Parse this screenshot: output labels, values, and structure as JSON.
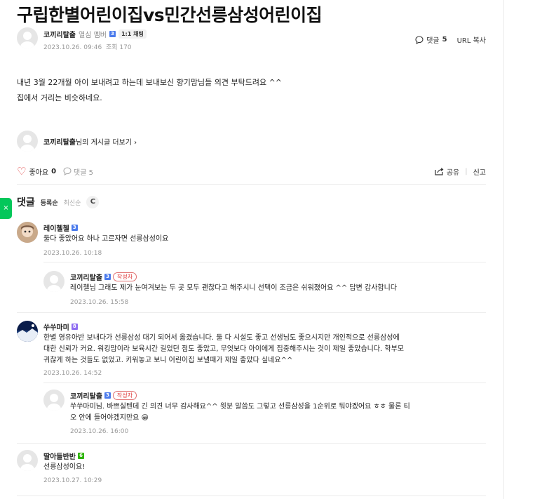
{
  "post": {
    "title": "구립한별어린이집vs민간선릉삼성어린이집",
    "author": "코끼리탈출",
    "grade": "열심 멤버",
    "grade_badge": "3",
    "chat_label": "1:1 채팅",
    "date": "2023.10.26. 09:46",
    "views": "조회 170",
    "comment_label": "댓글",
    "comment_count": "5",
    "url_copy": "URL 복사",
    "body_line1": "내년 3월 22개월 아이 보내려고 하는데 보내보신 향기맘님들 의견 부탁드려요 ^^",
    "body_line2": "집에서 거리는 비슷하네요.",
    "more_author": "코끼리탈출",
    "more_suffix": "님의 게시글 더보기 ›"
  },
  "reactions": {
    "like_label": "좋아요",
    "like_count": "0",
    "comment_label": "댓글 5",
    "share_label": "공유",
    "report_label": "신고"
  },
  "comments_section": {
    "heading": "댓글",
    "sort_registered": "등록순",
    "sort_latest": "최신순",
    "refresh_icon": "C"
  },
  "comments": [
    {
      "name": "레이첼첼",
      "badge": "3",
      "text": "둘다 좋았어요 하나 고르자면 선릉삼성이요",
      "date": "2023.10.26. 10:18"
    },
    {
      "name": "코끼리탈출",
      "badge": "3",
      "tag": "작성자",
      "text": "레이첼님 그래도 제가 눈여겨보는 두 곳 모두 괜찮다고 해주시니 선택이 조금은 쉬워졌어요 ^^ 답변 감사합니다",
      "date": "2023.10.26. 15:58"
    },
    {
      "name": "쑤쑤마미",
      "badge": "8",
      "text_l1": "한별 영유아반 보내다가 선릉삼성 대기 되어서 옮겼습니다. 둘 다 시설도 좋고 선생님도 좋으시지만 개인적으로 선릉삼성에",
      "text_l2": "대한 신뢰가 커요. 워킹맘이라 보육시간 길었던 점도 좋았고, 무엇보다 아이에게 집중해주시는 것이 제일 좋았습니다. 학부모",
      "text_l3": "귀찮게 하는 것들도 없었고. 키워놓고 보니 어린이집 보낼때가 제일 좋았다 싶네요^^",
      "date": "2023.10.26. 14:52"
    },
    {
      "name": "코끼리탈출",
      "badge": "3",
      "tag": "작성자",
      "text_l1": "쑤쑤마미님. 바쁘실텐데 긴 의견 너무 감사해요^^ 윗분 말씀도 그렇고 선릉삼성을 1순위로 둬야겠어요 ㅎㅎ 물론 티",
      "text_l2": "오 안에 들어야겠지만요 😀",
      "date": "2023.10.26. 16:00"
    },
    {
      "name": "딸아들반반",
      "badge": "6",
      "text": "선릉삼성이요!",
      "date": "2023.10.27. 10:29"
    }
  ],
  "colors": {
    "accent_green": "#03c75a",
    "like_red": "#e03b3b",
    "badge_blue": "#4b7bec"
  }
}
